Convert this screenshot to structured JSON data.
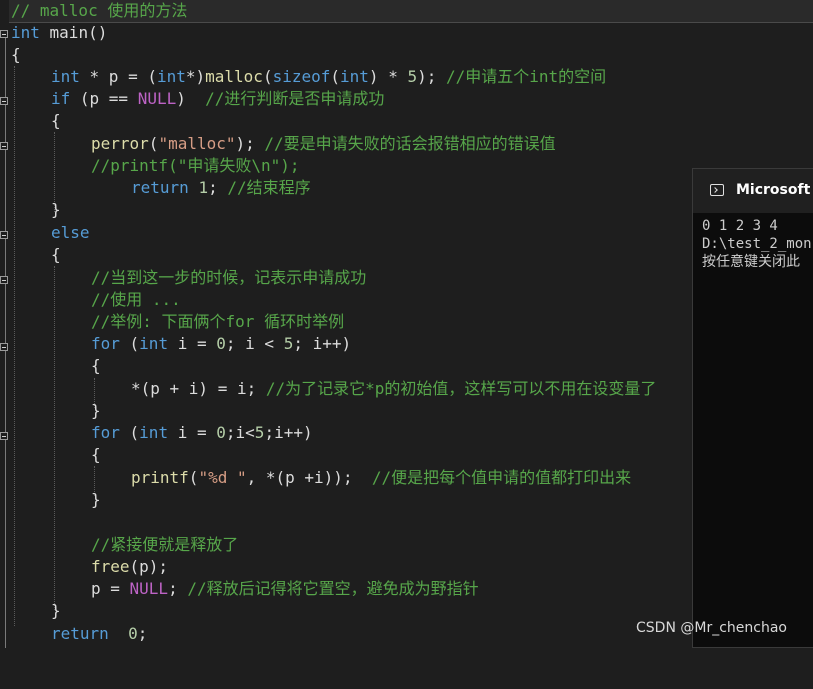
{
  "editor": {
    "header_comment": "// malloc 使用的方法",
    "lines": {
      "l1a": "int",
      "l1b": " main()",
      "l2": "{",
      "l3a": "int",
      "l3b": " * p = (",
      "l3c": "int",
      "l3d": "*)",
      "l3e": "malloc",
      "l3f": "(",
      "l3g": "sizeof",
      "l3h": "(",
      "l3i": "int",
      "l3j": ") * ",
      "l3k": "5",
      "l3l": "); ",
      "l3m": "//申请五个int的空间",
      "l4a": "if",
      "l4b": " (p == ",
      "l4c": "NULL",
      "l4d": ")  ",
      "l4e": "//进行判断是否申请成功",
      "l5": "{",
      "l6a": "perror",
      "l6b": "(",
      "l6c": "\"malloc\"",
      "l6d": "); ",
      "l6e": "//要是申请失败的话会报错相应的错误值",
      "l7": "//printf(\"申请失败\\n\");",
      "l8a": "return",
      "l8b": " ",
      "l8c": "1",
      "l8d": "; ",
      "l8e": "//结束程序",
      "l9": "}",
      "l10": "else",
      "l11": "{",
      "l12": "//当到这一步的时候，记表示申请成功",
      "l13": "//使用 ...",
      "l14": "//举例: 下面俩个for 循环时举例",
      "l15a": "for",
      "l15b": " (",
      "l15c": "int",
      "l15d": " i = ",
      "l15e": "0",
      "l15f": "; i < ",
      "l15g": "5",
      "l15h": "; i++)",
      "l16": "{",
      "l17a": "*(p + i) = i; ",
      "l17b": "//为了记录它*p的初始值，这样写可以不用在设变量了",
      "l18": "}",
      "l19a": "for",
      "l19b": " (",
      "l19c": "int",
      "l19d": " i = ",
      "l19e": "0",
      "l19f": ";i<",
      "l19g": "5",
      "l19h": ";i++)",
      "l20": "{",
      "l21a": "printf",
      "l21b": "(",
      "l21c": "\"%d \"",
      "l21d": ", *(p +i));  ",
      "l21e": "//便是把每个值申请的值都打印出来",
      "l22": "}",
      "l24": "//紧接便就是释放了",
      "l25a": "free",
      "l25b": "(p);",
      "l26a": "p = ",
      "l26b": "NULL",
      "l26c": "; ",
      "l26d": "//释放后记得将它置空，避免成为野指针",
      "l27": "}",
      "l28a": "return",
      "l28b": "  ",
      "l28c": "0",
      "l28d": ";"
    }
  },
  "console": {
    "title": "Microsoft Vi",
    "output_line1": "0 1 2 3 4",
    "output_line2": "D:\\test_2_mon",
    "output_line3": "按任意键关闭此"
  },
  "watermark": "CSDN @Mr_chenchao",
  "colors": {
    "background": "#1e1e1e",
    "keyword": "#569cd6",
    "function": "#dcdcaa",
    "string": "#d69d85",
    "comment": "#57a64a",
    "number": "#b5cea8",
    "macro": "#bd63c5"
  }
}
